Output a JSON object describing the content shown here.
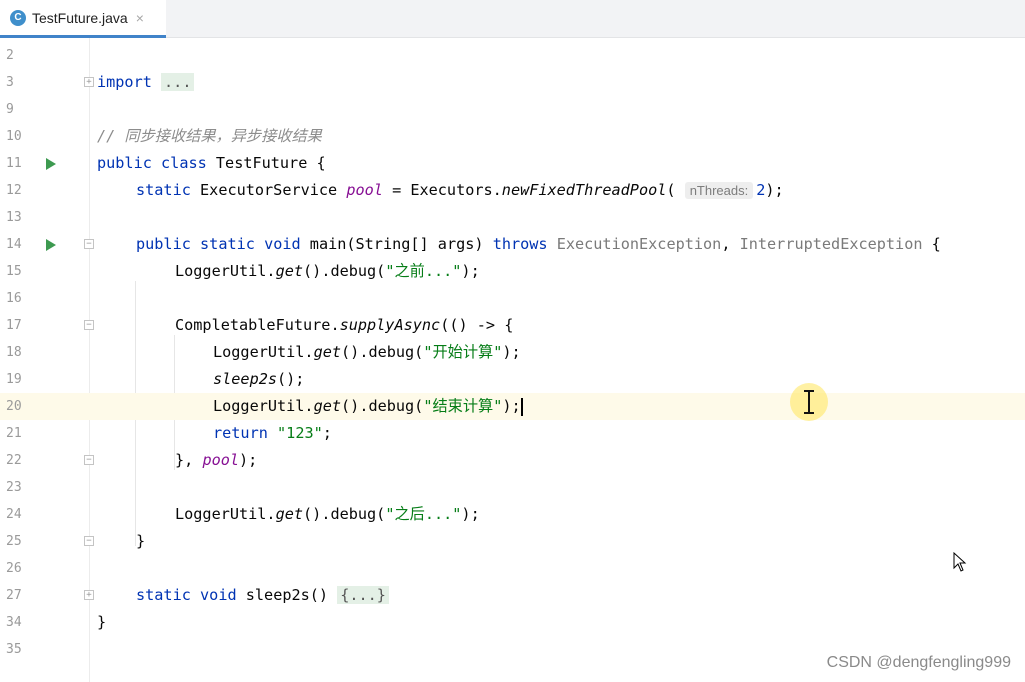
{
  "tab": {
    "icon_letter": "C",
    "file_name": "TestFuture.java",
    "close": "×",
    "icon": "java-class-icon"
  },
  "lines": {
    "l2": {
      "num": "2"
    },
    "l3": {
      "num": "3",
      "kw": "import",
      "fold": "..."
    },
    "l9": {
      "num": "9"
    },
    "l10": {
      "num": "10",
      "comment": "// 同步接收结果，异步接收结果"
    },
    "l11": {
      "num": "11",
      "kw1": "public",
      "kw2": "class",
      "rest": "TestFuture {"
    },
    "l12": {
      "num": "12",
      "kw": "static",
      "type": "ExecutorService",
      "field": "pool",
      "eq": " = Executors.",
      "call": "newFixedThreadPool",
      "open": "(",
      "hint": "nThreads:",
      "arg": "2",
      "close": ");"
    },
    "l13": {
      "num": "13"
    },
    "l14": {
      "num": "14",
      "kw1": "public",
      "kw2": "static",
      "kw3": "void",
      "name": "main(String[] args)",
      "throws": "throws",
      "ex1": "ExecutionException",
      "sep": ", ",
      "ex2": "InterruptedException",
      "brace": " {"
    },
    "l15": {
      "num": "15",
      "cls": "LoggerUtil.",
      "get": "get",
      "mid": "().debug(",
      "str": "\"之前...\"",
      "end": ");"
    },
    "l16": {
      "num": "16"
    },
    "l17": {
      "num": "17",
      "cls": "CompletableFuture.",
      "call": "supplyAsync",
      "rest": "(() -> {"
    },
    "l18": {
      "num": "18",
      "cls": "LoggerUtil.",
      "get": "get",
      "mid": "().debug(",
      "str": "\"开始计算\"",
      "end": ");"
    },
    "l19": {
      "num": "19",
      "call": "sleep2s",
      "end": "();"
    },
    "l20": {
      "num": "20",
      "cls": "LoggerUtil.",
      "get": "get",
      "mid": "().debug(",
      "str": "\"结束计算\"",
      "end": ");"
    },
    "l21": {
      "num": "21",
      "kw": "return",
      "str": "\"123\"",
      "end": ";"
    },
    "l22": {
      "num": "22",
      "start": "}, ",
      "field": "pool",
      "end": ");"
    },
    "l23": {
      "num": "23"
    },
    "l24": {
      "num": "24",
      "cls": "LoggerUtil.",
      "get": "get",
      "mid": "().debug(",
      "str": "\"之后...\"",
      "end": ");"
    },
    "l25": {
      "num": "25",
      "brace": "}"
    },
    "l26": {
      "num": "26"
    },
    "l27": {
      "num": "27",
      "kw1": "static",
      "kw2": "void",
      "name": "sleep2s()",
      "fold": "{...}"
    },
    "l34": {
      "num": "34",
      "brace": "}"
    },
    "l35": {
      "num": "35"
    }
  },
  "watermark": "CSDN @dengfengling999",
  "colors": {
    "keyword": "#0033b3",
    "string": "#067d17",
    "comment": "#8c8c8c",
    "field": "#871094",
    "run": "#3d9a50",
    "tab_accent": "#4083c9"
  }
}
